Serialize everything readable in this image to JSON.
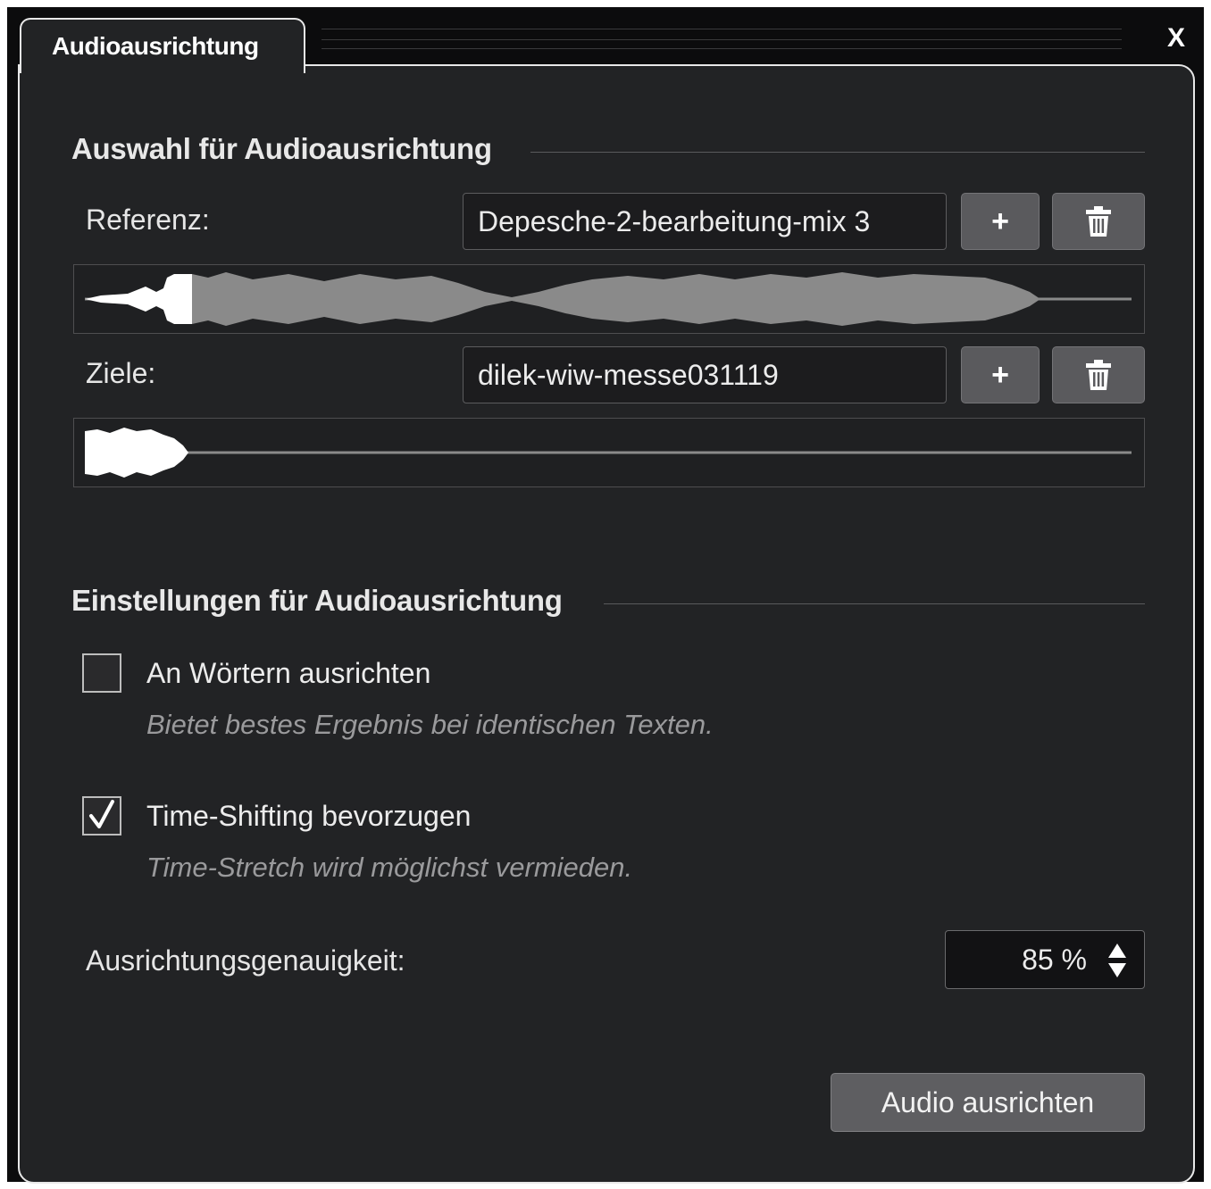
{
  "window": {
    "tab_title": "Audioausrichtung",
    "close_label": "X"
  },
  "selection": {
    "title": "Auswahl für Audioausrichtung",
    "reference": {
      "label": "Referenz:",
      "value": "Depesche-2-bearbeitung-mix 3",
      "add_label": "+"
    },
    "targets": {
      "label": "Ziele:",
      "value": "dilek-wiw-messe031119",
      "add_label": "+"
    }
  },
  "settings": {
    "title": "Einstellungen für Audioausrichtung",
    "align_words": {
      "label": "An Wörtern ausrichten",
      "hint": "Bietet bestes Ergebnis bei identischen Texten.",
      "checked": false
    },
    "prefer_time_shift": {
      "label": "Time-Shifting bevorzugen",
      "hint": "Time-Stretch wird möglichst vermieden.",
      "checked": true
    },
    "accuracy": {
      "label": "Ausrichtungsgenauigkeit:",
      "value": "85 %"
    }
  },
  "action": {
    "label": "Audio ausrichten"
  },
  "colors": {
    "panel": "#222325",
    "accent": "#e8e8e8",
    "waveform_gray": "#8a8a8a",
    "waveform_white": "#ffffff"
  }
}
